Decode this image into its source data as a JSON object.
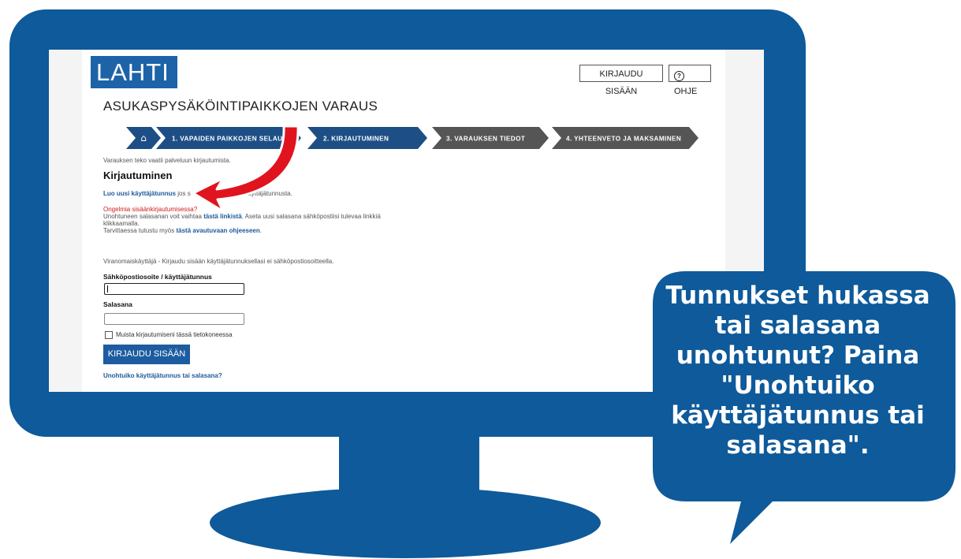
{
  "header": {
    "logo_text": "LAHTI",
    "login_button": "KIRJAUDU SISÄÄN",
    "help_button": "OHJE",
    "help_icon_glyph": "?"
  },
  "page_title": "ASUKASPYSÄKÖINTIPAIKKOJEN VARAUS",
  "steps": {
    "home_icon": "⌂",
    "step1": "1. VAPAIDEN PAIKKOJEN SELAUS",
    "step2": "2. KIRJAUTUMINEN",
    "step3": "3. VARAUKSEN TIEDOT",
    "step4": "4. YHTEENVETO JA MAKSAMINEN",
    "active_color": "#1d4f86",
    "inactive_color": "#555555"
  },
  "content": {
    "intro": "Varauksen teko vaatii palveluun kirjautumista.",
    "heading": "Kirjautuminen",
    "create_account_link": "Luo uusi käyttäjätunnus",
    "create_account_rest_a": " jos s",
    "create_account_rest_b": "a käyttäjätunnusta.",
    "problems": "Ongelmia sisäänkirjautumisessa?",
    "reset_text_a": "Unohtuneen salasanan voit vaihtaa ",
    "reset_link": "tästä linkistä",
    "reset_text_b": ". Aseta uusi salasana sähköpostiisi tulevaa linkkiä",
    "reset_text_c": "klikkaamalla.",
    "guide_text": "Tarvittaessa tutustu myös ",
    "guide_link": "tästä avautuvaan ohjeeseen",
    "guide_end": ".",
    "authority_text": "Viranomaiskäyttäjä - Kirjaudu sisään käyttäjätunnuksellasi ei sähköpostiosoitteella.",
    "username_label": "Sähköpostiosoite / käyttäjätunnus",
    "password_label": "Salasana",
    "remember_label": "Muista kirjautumiseni tässä tietokoneessa",
    "login_button": "KIRJAUDU SISÄÄN",
    "forgot_link": "Unohtuiko käyttäjätunnus tai salasana?"
  },
  "callout": {
    "lines": [
      "Tunnukset hukassa",
      "tai salasana",
      "unohtunut? Paina",
      "\"Unohtuiko",
      "käyttäjätunnus tai",
      "salasana\"."
    ],
    "color": "#0e5a9a"
  }
}
